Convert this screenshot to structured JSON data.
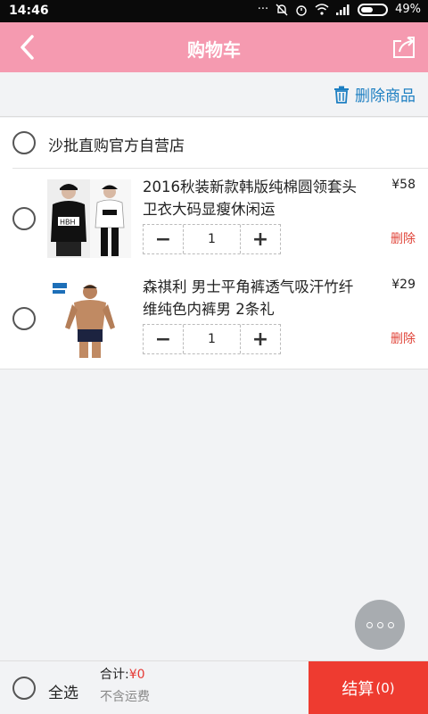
{
  "status_bar": {
    "time": "14:46",
    "battery": "49%"
  },
  "header": {
    "title": "购物车"
  },
  "toolbar": {
    "delete_label": "删除商品"
  },
  "store": {
    "name": "沙批直购官方自营店"
  },
  "items": [
    {
      "title": "2016秋装新款韩版纯棉圆领套头卫衣大码显瘦休闲运",
      "price": "¥58",
      "quantity": "1",
      "minus": "−",
      "plus": "+",
      "delete_label": "删除"
    },
    {
      "title": "森祺利 男士平角裤透气吸汗竹纤维纯色内裤男 2条礼",
      "price": "¥29",
      "quantity": "1",
      "minus": "−",
      "plus": "+",
      "delete_label": "删除"
    }
  ],
  "footer": {
    "select_all": "全选",
    "total_label": "合计:",
    "total_amount": "¥0",
    "freight_note": "不含运费",
    "checkout_label": "结算",
    "checkout_count": "(0)"
  },
  "colors": {
    "header": "#f59ab0",
    "accent_blue": "#1d7fc2",
    "checkout": "#ee3b30",
    "price_red": "#e53935"
  }
}
